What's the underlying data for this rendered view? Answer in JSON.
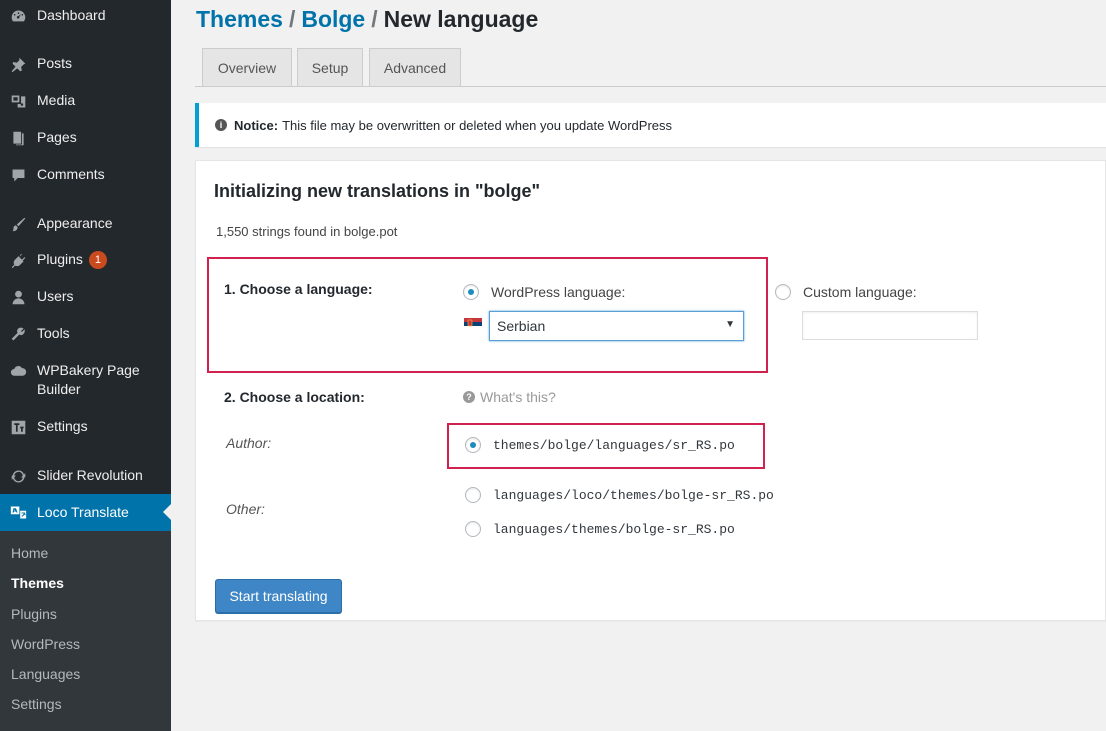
{
  "sidebar": {
    "items": [
      {
        "label": "Dashboard",
        "icon": "dashboard-icon"
      },
      {
        "label": "Posts",
        "icon": "pin-icon"
      },
      {
        "label": "Media",
        "icon": "media-icon"
      },
      {
        "label": "Pages",
        "icon": "pages-icon"
      },
      {
        "label": "Comments",
        "icon": "comment-icon"
      },
      {
        "label": "Appearance",
        "icon": "brush-icon"
      },
      {
        "label": "Plugins",
        "icon": "plug-icon",
        "badge": "1"
      },
      {
        "label": "Users",
        "icon": "user-icon"
      },
      {
        "label": "Tools",
        "icon": "wrench-icon"
      },
      {
        "label": "WPBakery Page Builder",
        "icon": "cloud-icon"
      },
      {
        "label": "Settings",
        "icon": "settings-icon"
      },
      {
        "label": "Slider Revolution",
        "icon": "refresh-icon"
      },
      {
        "label": "Loco Translate",
        "icon": "translate-icon",
        "active": true
      }
    ],
    "submenu": [
      {
        "label": "Home"
      },
      {
        "label": "Themes",
        "current": true
      },
      {
        "label": "Plugins"
      },
      {
        "label": "WordPress"
      },
      {
        "label": "Languages"
      },
      {
        "label": "Settings"
      }
    ]
  },
  "breadcrumb": {
    "themes": "Themes",
    "separator": "/",
    "bolge": "Bolge",
    "current": "New language"
  },
  "tabs": [
    {
      "label": "Overview"
    },
    {
      "label": "Setup"
    },
    {
      "label": "Advanced"
    }
  ],
  "notice": {
    "title": "Notice:",
    "text": "This file may be overwritten or deleted when you update WordPress"
  },
  "panel": {
    "heading": "Initializing new translations in \"bolge\"",
    "strings_found": "1,550 strings found in bolge.pot",
    "step1": {
      "label": "1. Choose a language:",
      "wp_language_label": "WordPress language:",
      "selected_language": "Serbian",
      "custom_language_label": "Custom language:",
      "custom_language_value": ""
    },
    "step2": {
      "label": "2. Choose a location:",
      "whats_this": "What's this?",
      "author_label": "Author:",
      "other_label": "Other:",
      "options": [
        {
          "path": "themes/bolge/languages/sr_RS.po",
          "checked": true
        },
        {
          "path": "languages/loco/themes/bolge-sr_RS.po",
          "checked": false
        },
        {
          "path": "languages/themes/bolge-sr_RS.po",
          "checked": false
        }
      ]
    },
    "start_button": "Start translating"
  },
  "colors": {
    "sidebar_bg": "#23282d",
    "submenu_bg": "#32373c",
    "accent": "#0073aa",
    "highlight_box": "#d0214f",
    "button": "#3f86c7",
    "badge": "#ca4a1f"
  }
}
